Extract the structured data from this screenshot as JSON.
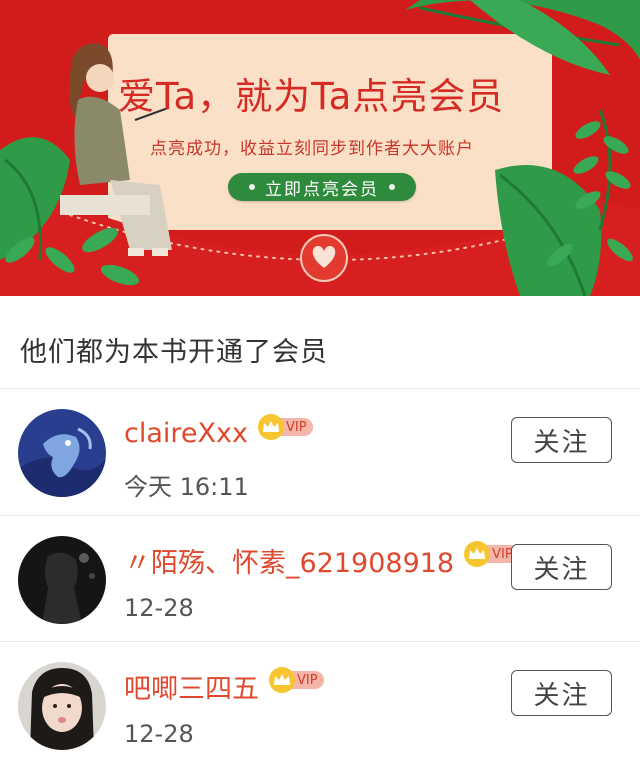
{
  "banner": {
    "headline": "爱Ta，就为Ta点亮会员",
    "subline": "点亮成功，收益立刻同步到作者大大账户",
    "cta_label": "立即点亮会员"
  },
  "section": {
    "title": "他们都为本书开通了会员"
  },
  "members": [
    {
      "name": "claireXxx",
      "vip_label": "VIP",
      "time": "今天 16:11",
      "follow_label": "关注"
    },
    {
      "name": "〃陌殇、怀素_621908918",
      "vip_label": "VIP",
      "time": "12-28",
      "follow_label": "关注"
    },
    {
      "name": "吧唧三四五",
      "vip_label": "VIP",
      "time": "12-28",
      "follow_label": "关注"
    }
  ],
  "colors": {
    "banner_red": "#d21c1c",
    "card_cream": "#fbe0c8",
    "cta_green": "#2e8b3c",
    "name_red": "#e0492d",
    "vip_gold": "#f6c530"
  }
}
